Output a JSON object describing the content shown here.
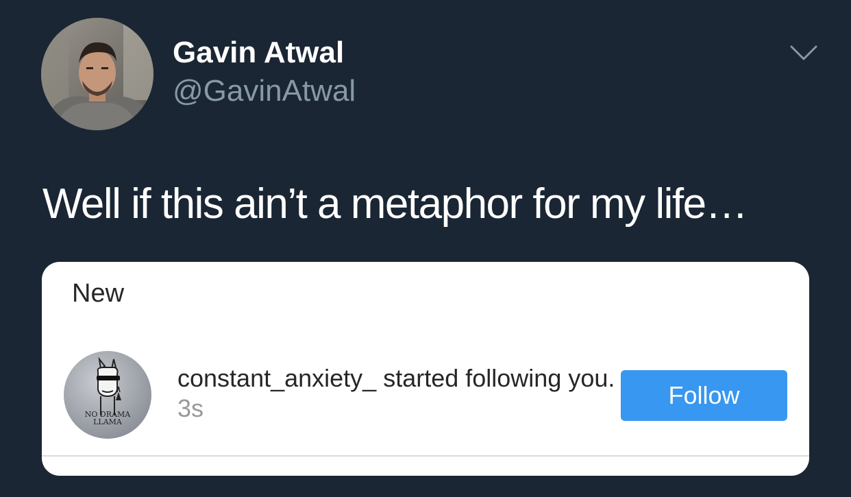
{
  "tweet": {
    "author_name": "Gavin Atwal",
    "author_handle": "@GavinAtwal",
    "text": "Well if this ain’t a metaphor for my life…",
    "menu_icon": "chevron-down-icon"
  },
  "embedded_notification": {
    "section_title": "New",
    "username": "constant_anxiety_",
    "action": " started following you.",
    "timestamp": "3s",
    "button_label": "Follow",
    "button_color": "#3897f0",
    "avatar": {
      "logo_text_line1": "NO DRAMA",
      "logo_text_line2": "LLAMA"
    }
  },
  "colors": {
    "background": "#1b2634",
    "secondary_text": "#8899a6"
  }
}
